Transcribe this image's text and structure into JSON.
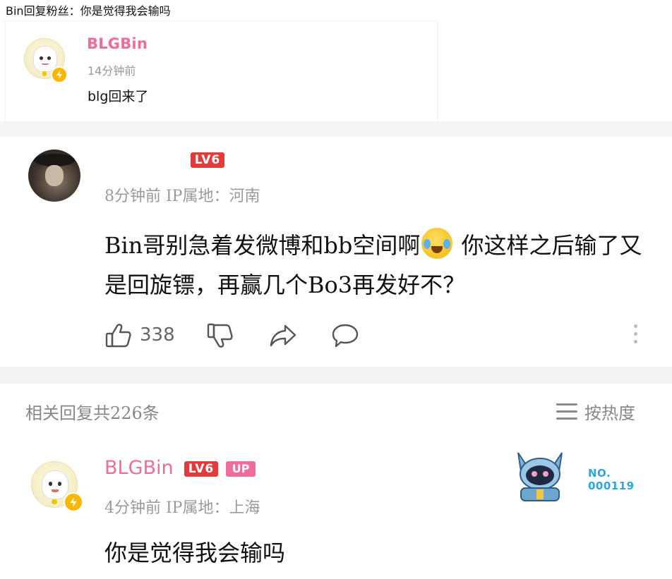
{
  "caption": "Bin回复粉丝：你是觉得我会输吗",
  "card1": {
    "username": "BLGBin",
    "time": "14分钟前",
    "text": "blg回来了"
  },
  "comment": {
    "level": "LV6",
    "meta": "8分钟前 IP属地：河南",
    "text_part1": "Bin哥别急着发微博和bb空间啊",
    "text_part2": "你这样之后输了又是回旋镖，再赢几个Bo3再发好不？",
    "likes": "338",
    "icons": [
      "thumbs-up-icon",
      "thumbs-down-icon",
      "share-icon",
      "comment-icon",
      "more-icon"
    ]
  },
  "replies": {
    "count_label": "相关回复共226条",
    "sort_label": "按热度"
  },
  "reply": {
    "username": "BLGBin",
    "level": "LV6",
    "up_label": "UP",
    "meta": "4分钟前 IP属地：上海",
    "text": "你是觉得我会输吗",
    "fan_no_label": "NO.",
    "fan_no_value": "000119"
  },
  "colors": {
    "username_pink": "#f06c9b",
    "level_red": "#e33b3b",
    "fan_blue": "#2aa6e0",
    "bolt_yellow": "#f8b700"
  }
}
